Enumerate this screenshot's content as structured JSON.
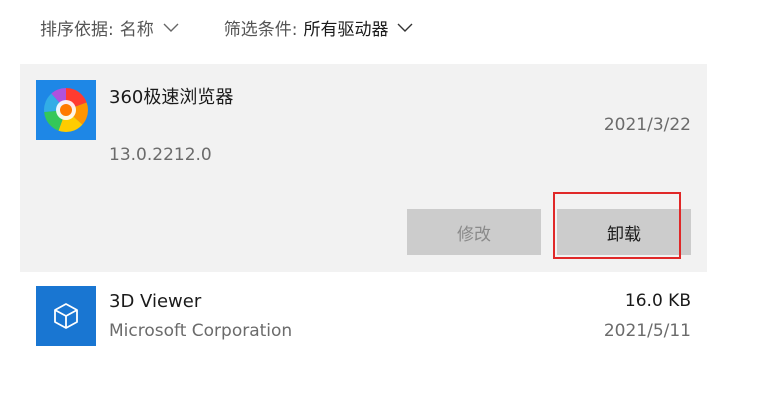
{
  "filters": {
    "sort_label": "排序依据:",
    "sort_value": "名称",
    "filter_label": "筛选条件:",
    "filter_value": "所有驱动器"
  },
  "apps": [
    {
      "name": "360极速浏览器",
      "version": "13.0.2212.0",
      "date": "2021/3/22",
      "icon": "360-browser-icon",
      "selected": true,
      "modify_label": "修改",
      "uninstall_label": "卸载"
    },
    {
      "name": "3D Viewer",
      "publisher": "Microsoft Corporation",
      "size": "16.0 KB",
      "date": "2021/5/11",
      "icon": "3d-viewer-icon",
      "selected": false
    }
  ],
  "colors": {
    "card_bg": "#f2f2f2",
    "button_bg": "#cccccc",
    "highlight": "#e02828",
    "viewer_blue": "#1976d2",
    "browser_blue": "#1e87e6"
  }
}
